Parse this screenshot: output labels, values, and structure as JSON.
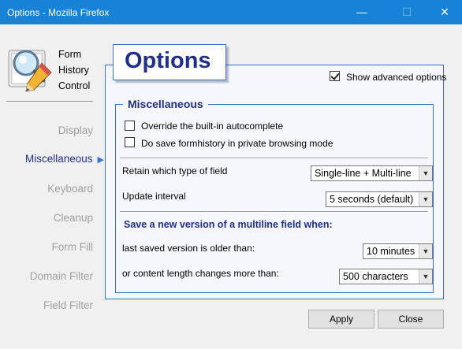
{
  "window": {
    "title": "Options - Mozilla Firefox",
    "minimize_glyph": "—",
    "maximize_glyph": "☐",
    "close_glyph": "✕"
  },
  "logo": {
    "text_lines": [
      "Form",
      "History",
      "Control"
    ]
  },
  "nav": {
    "items": [
      {
        "label": "Display",
        "active": false
      },
      {
        "label": "Miscellaneous",
        "active": true
      },
      {
        "label": "Keyboard",
        "active": false
      },
      {
        "label": "Cleanup",
        "active": false
      },
      {
        "label": "Form Fill",
        "active": false
      },
      {
        "label": "Domain Filter",
        "active": false
      },
      {
        "label": "Field Filter",
        "active": false
      }
    ],
    "active_arrow": "▶"
  },
  "header": {
    "title": "Options"
  },
  "advanced": {
    "label": "Show advanced options",
    "checked": true
  },
  "misc": {
    "legend": "Miscellaneous",
    "override_autocomplete": {
      "label": "Override the built-in autocomplete",
      "checked": false
    },
    "private_mode": {
      "label": "Do save formhistory in private browsing mode",
      "checked": false
    },
    "retain_type": {
      "label": "Retain which type of field",
      "value": "Single-line + Multi-line"
    },
    "update_interval": {
      "label": "Update interval",
      "value": "5 seconds (default)"
    },
    "multiline_heading": "Save a new version of a multiline field when:",
    "older_than": {
      "label": "last saved version is older than:",
      "value": "10 minutes"
    },
    "length_change": {
      "label": "or content length changes more than:",
      "value": "500 characters"
    }
  },
  "buttons": {
    "apply": "Apply",
    "close": "Close"
  },
  "colors": {
    "titlebar": "#1683d8",
    "accent": "#3c6fc6",
    "heading": "#1f2f8a",
    "nav_inactive": "#a0a0a0"
  }
}
